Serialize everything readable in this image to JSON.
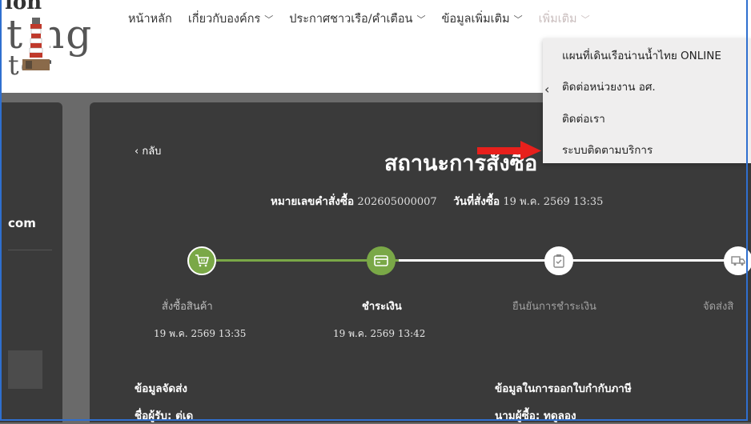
{
  "logo": {
    "line1": "ion",
    "line2": "ting",
    "line3": "ter"
  },
  "nav": {
    "home": "หน้าหลัก",
    "about": "เกี่ยวกับองค์กร",
    "notices": "ประกาศชาวเรือ/คำเตือน",
    "moreinfo": "ข้อมูลเพิ่มเติม",
    "more": "เพิ่มเติม"
  },
  "dropdown": {
    "items": [
      "แผนที่เดินเรือน่านน้ำไทย ONLINE",
      "ติดต่อหน่วยงาน อศ.",
      "ติดต่อเรา",
      "ระบบติดตามบริการ"
    ]
  },
  "sidebar": {
    "brand": "com"
  },
  "main": {
    "back": "‹ กลับ",
    "title": "สถานะการสั่งซื้อ",
    "order_no_label": "หมายเลขคำสั่งซื้อ",
    "order_no": "202605000007",
    "order_date_label": "วันที่สั่งซื้อ",
    "order_date": "19 พ.ค. 2569 13:35"
  },
  "steps": [
    {
      "label": "สั่งซื้อสินค้า",
      "date": "19 พ.ค. 2569 13:35",
      "icon": "cart-icon",
      "status": "done"
    },
    {
      "label": "ชำระเงิน",
      "date": "19 พ.ค. 2569 13:42",
      "icon": "card-icon",
      "status": "current"
    },
    {
      "label": "ยืนยันการชำระเงิน",
      "date": "",
      "icon": "clipboard-check-icon",
      "status": "pending"
    },
    {
      "label": "จัดส่งสิ",
      "date": "",
      "icon": "truck-icon",
      "status": "pending"
    }
  ],
  "shipping": {
    "title": "ข้อมูลจัดส่ง",
    "recipient": "ชื่อผู้รับ: ต่เด"
  },
  "tax": {
    "title": "ข้อมูลในการออกใบกำกับภาษี",
    "buyer": "นามผู้ซื้อ: ทดูลอง"
  },
  "colors": {
    "green": "#7aa847",
    "panel": "#3a3a3a",
    "bg": "#6a6a6a",
    "arrow": "#e8201c"
  }
}
